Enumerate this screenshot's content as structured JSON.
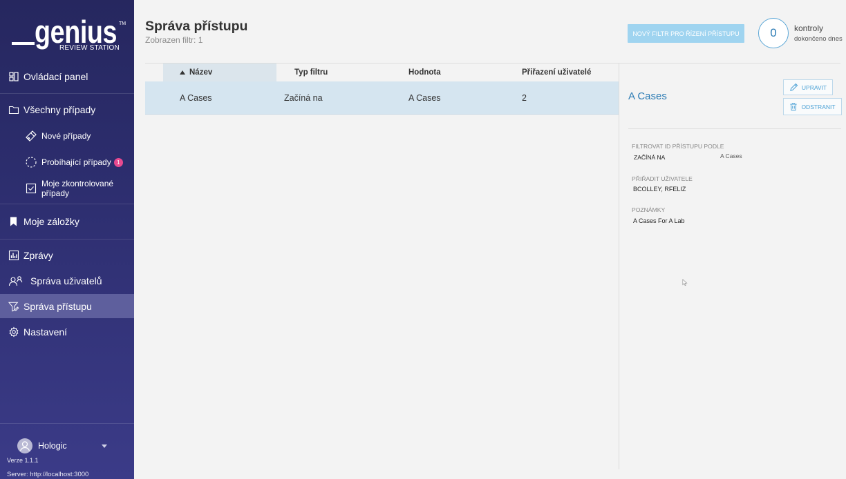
{
  "app": {
    "logo_word": "genius",
    "logo_trademark": "TM",
    "logo_subtitle": "REVIEW STATION"
  },
  "colors": {
    "sidebar_top": "#26275f",
    "sidebar_bottom": "#3b3b88",
    "sidebar_active": "#5e5f9d",
    "accent": "#2b7bb4",
    "primary_button": "#9fd4f0",
    "badge": "#e8498f",
    "selected_row": "#d5e5f0"
  },
  "sidebar": {
    "items": [
      {
        "label": "Ovládací panel",
        "icon": "dashboard-icon"
      },
      {
        "label": "Všechny případy",
        "icon": "folder-icon"
      },
      {
        "label": "Nové případy",
        "icon": "tag-icon"
      },
      {
        "label": "Probíhající případy",
        "icon": "dashed-circle-icon",
        "badge": "1"
      },
      {
        "label": "Moje zkontrolované případy",
        "icon": "checkbox-icon"
      },
      {
        "label": "Moje záložky",
        "icon": "bookmark-icon"
      },
      {
        "label": "Zprávy",
        "icon": "bar-chart-icon"
      },
      {
        "label": "Správa uživatelů",
        "icon": "users-icon"
      },
      {
        "label": "Správa přístupu",
        "icon": "filter-icon",
        "active": true
      },
      {
        "label": "Nastavení",
        "icon": "gear-icon"
      }
    ],
    "user": {
      "name": "Hologic",
      "icon": "avatar-icon",
      "version": "Verze 1.1.1",
      "server": "Server: http://localhost:3000"
    }
  },
  "header": {
    "title": "Správa přístupu",
    "subtitle": "Zobrazen filtr: 1",
    "new_filter_button": "NOVÝ FILTR PRO ŘÍZENÍ PŘÍSTUPU",
    "reviews_count": "0",
    "reviews_label": "kontroly",
    "reviews_sublabel": "dokončeno dnes"
  },
  "table": {
    "sort_icon": "sort-ascending-icon",
    "columns": [
      "Název",
      "Typ filtru",
      "Hodnota",
      "Přiřazení uživatelé"
    ],
    "rows": [
      [
        "A Cases",
        "Začíná na",
        "A Cases",
        "2"
      ]
    ],
    "selected_row": 0
  },
  "detail": {
    "title": "A Cases",
    "edit_button": "UPRAVIT",
    "delete_button": "ODSTRANIT",
    "fields": [
      {
        "label": "FILTROVAT ID PŘÍSTUPU PODLE",
        "value": "ZAČÍNÁ NA",
        "value_extra": "A Cases"
      },
      {
        "label": "PŘIŘADIT UŽIVATELE",
        "value": "BCOLLEY, RFELIZ"
      },
      {
        "label": "POZNÁMKY",
        "value": "A Cases For A Lab"
      }
    ]
  }
}
